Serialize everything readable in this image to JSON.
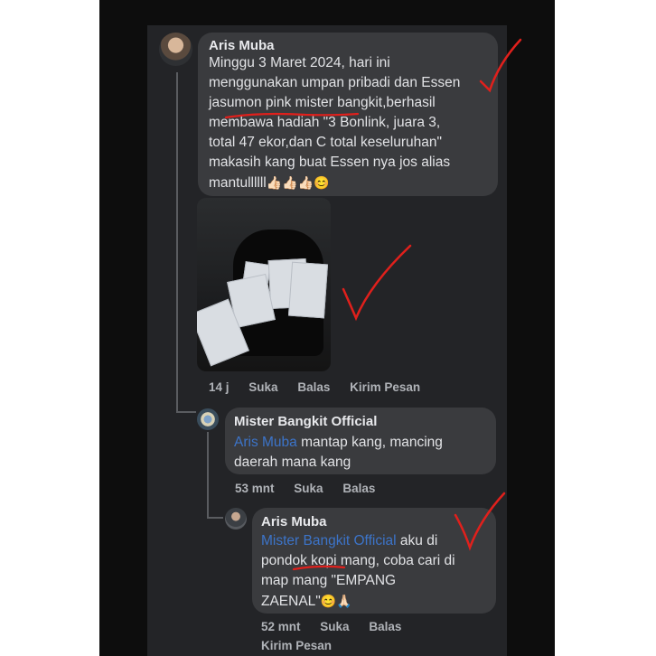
{
  "comments": [
    {
      "author": "Aris Muba",
      "text": "Minggu 3 Maret 2024, hari ini\nmenggunakan umpan pribadi dan Essen\njasumon pink mister bangkit,berhasil\nmembawa hadiah \"3 Bonlink, juara 3,\ntotal 47 ekor,dan C total keseluruhan\"\nmakasih kang buat Essen nya jos alias\nmantullllll",
      "emoji": "👍🏻👍🏻👍🏻😊",
      "time": "14 j",
      "actions": [
        "Suka",
        "Balas",
        "Kirim Pesan"
      ]
    },
    {
      "author": "Mister Bangkit Official",
      "mention": "Aris Muba",
      "text": " mantap kang, mancing\ndaerah mana kang",
      "time": "53 mnt",
      "actions": [
        "Suka",
        "Balas"
      ]
    },
    {
      "author": "Aris Muba",
      "mention": "Mister Bangkit Official",
      "text": " aku di\npondok kopi mang, coba cari di\nmap mang \"EMPANG\nZAENAL\"",
      "emoji": "😊🙏🏻",
      "time": "52 mnt",
      "actions": [
        "Suka",
        "Balas"
      ],
      "extra_action": "Kirim Pesan"
    }
  ],
  "icons": {
    "photo": "fishing-prize-envelopes-photo",
    "check_marks": "red-check-mark-annotation"
  },
  "colors": {
    "background": "#232427",
    "bubble": "#3a3b3e",
    "mention": "#3c74c9",
    "annotation": "#e0201c"
  }
}
